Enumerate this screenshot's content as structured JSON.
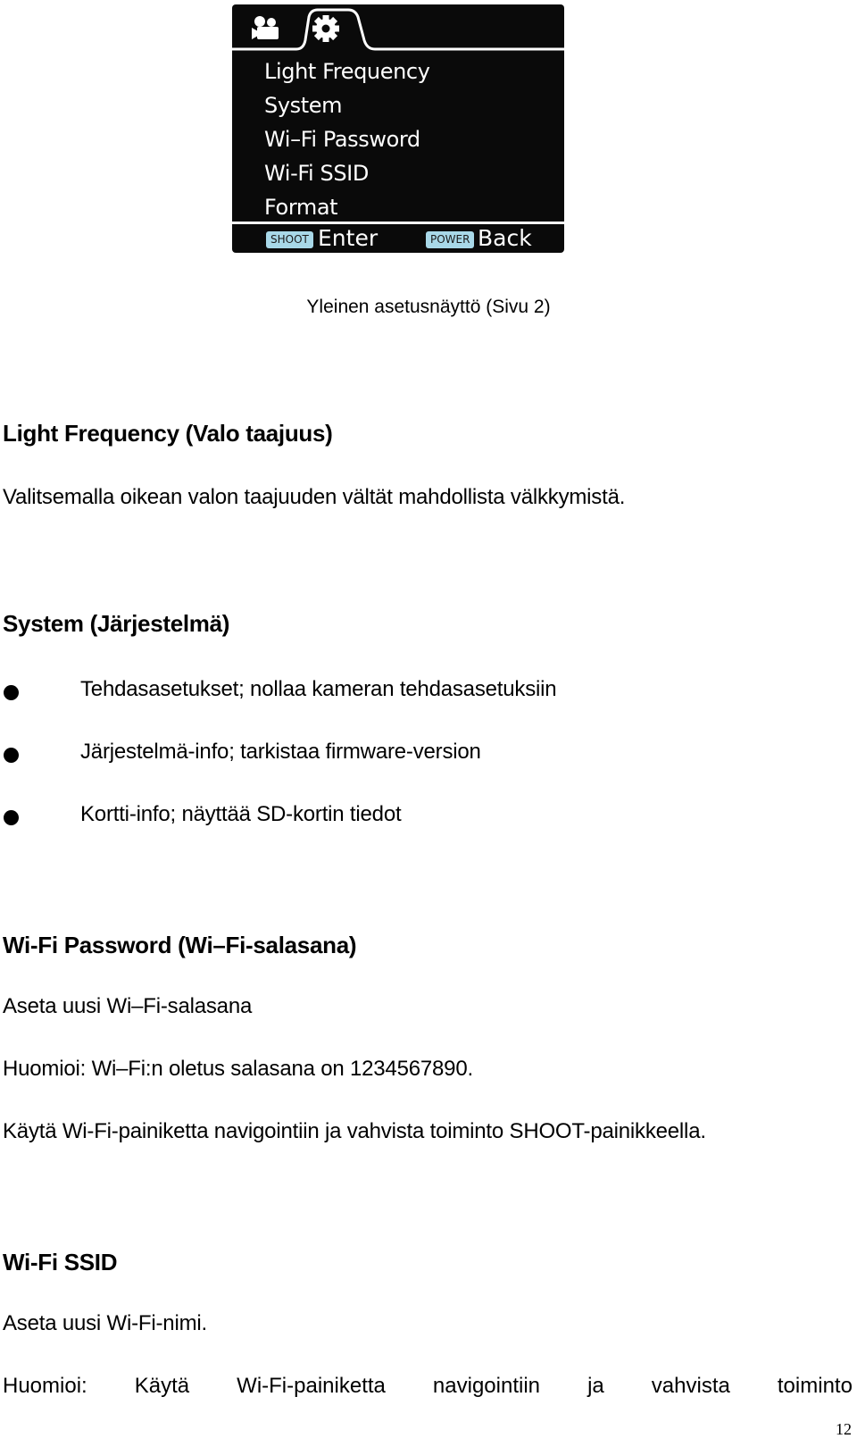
{
  "camera_screen": {
    "tabs": [
      {
        "icon": "video-camera-icon",
        "active": false
      },
      {
        "icon": "gear-icon",
        "active": true
      }
    ],
    "menu_items": [
      "Light Frequency",
      "System",
      "Wi–Fi Password",
      "Wi-Fi SSID",
      "Format"
    ],
    "footer": {
      "enter_key": "SHOOT",
      "enter_label": "Enter",
      "back_key": "POWER",
      "back_label": "Back"
    },
    "colors": {
      "background": "#0a0a0a",
      "key_badge": "#a8d8e8",
      "text": "#ffffff"
    }
  },
  "caption": "Yleinen asetusnäyttö (Sivu 2)",
  "sections": {
    "light_frequency": {
      "heading": "Light Frequency (Valo taajuus)",
      "body": "Valitsemalla oikean valon taajuuden vältät mahdollista välkkymistä."
    },
    "system": {
      "heading": "System (Järjestelmä)",
      "bullets": [
        "Tehdasasetukset; nollaa kameran tehdasasetuksiin",
        "Järjestelmä-info; tarkistaa firmware-version",
        "Kortti-info; näyttää SD-kortin tiedot"
      ]
    },
    "wifi_password": {
      "heading": "Wi-Fi Password (Wi–Fi-salasana)",
      "lines": [
        "Aseta uusi Wi–Fi-salasana",
        "Huomioi: Wi–Fi:n oletus salasana on 1234567890.",
        "Käytä Wi-Fi-painiketta navigointiin ja vahvista toiminto SHOOT-painikkeella."
      ]
    },
    "wifi_ssid": {
      "heading": "Wi-Fi SSID",
      "line1": "Aseta uusi Wi-Fi-nimi.",
      "line2_words": [
        "Huomioi:",
        "Käytä",
        "Wi-Fi-painiketta",
        "navigointiin",
        "ja",
        "vahvista",
        "toiminto"
      ]
    }
  },
  "page_number": "12"
}
